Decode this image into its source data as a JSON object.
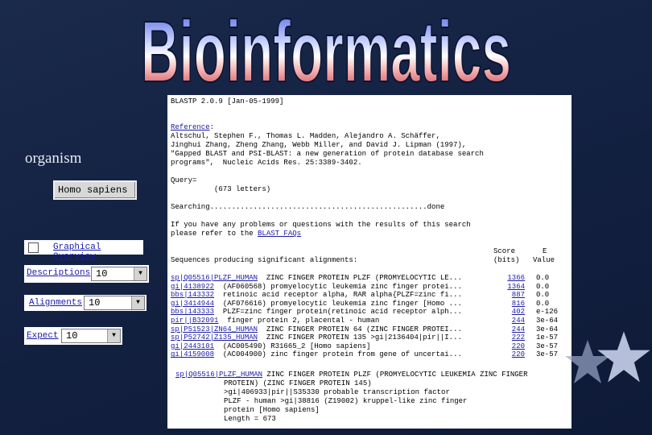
{
  "title": "Bioinformatics",
  "organism": {
    "label": "organism",
    "value": "Homo sapiens"
  },
  "options": {
    "graphical_overview": "Graphical Overview",
    "descriptions": {
      "label": "Descriptions",
      "value": "10"
    },
    "alignments": {
      "label": "Alignments",
      "value": "10"
    },
    "expect": {
      "label": "Expect",
      "value": "10"
    }
  },
  "result": {
    "version": "BLASTP 2.0.9 [Jan-05-1999]",
    "reference_label": "Reference",
    "reference_lines": [
      "Altschul, Stephen F., Thomas L. Madden, Alejandro A. Schäffer,",
      "Jinghui Zhang, Zheng Zhang, Webb Miller, and David J. Lipman (1997),",
      "\"Gapped BLAST and PSI-BLAST: a new generation of protein database search",
      "programs\",  Nucleic Acids Res. 25:3389-3402."
    ],
    "query_label": "Query=",
    "query_letters": "(673 letters)",
    "searching": "Searching..................................................done",
    "problems_line1": "If you have any problems or questions with the results of this search",
    "problems_line2": "please refer to the",
    "faq_link": "BLAST FAQs",
    "col_score": "Score",
    "col_bits": "(bits)",
    "col_e": "E",
    "col_value": "Value",
    "sequences_heading": "Sequences producing significant alignments:",
    "hits": [
      {
        "acc": "sp|Q05516|PLZF_HUMAN",
        "desc": "  ZINC FINGER PROTEIN PLZF (PROMYELOCYTIC LE...",
        "score": "1366",
        "e": "0.0"
      },
      {
        "acc": "gi|4138922",
        "desc": "  (AF060568) promyelocytic leukemia zinc finger protei...",
        "score": "1364",
        "e": "0.0"
      },
      {
        "acc": "bbs|143332",
        "desc": "  retinoic acid receptor alpha, RAR alpha{PLZF=zinc fi...",
        "score": "887",
        "e": "0.0"
      },
      {
        "acc": "gi|3414944",
        "desc": "  (AF076616) promyelocytic leukemia zinc finger [Homo ...",
        "score": "816",
        "e": "0.0"
      },
      {
        "acc": "bbs|143333",
        "desc": "  PLZF=zinc finger protein(retinoic acid receptor alph...",
        "score": "402",
        "e": "e-126"
      },
      {
        "acc": "pir||B32091",
        "desc": "  finger protein 2, placental - human",
        "score": "244",
        "e": "3e-64"
      },
      {
        "acc": "sp|P51523|ZN64_HUMAN",
        "desc": "  ZINC FINGER PROTEIN 64 (ZINC FINGER PROTEI...",
        "score": "244",
        "e": "3e-64"
      },
      {
        "acc": "sp|P52742|Z135_HUMAN",
        "desc": "  ZINC FINGER PROTEIN 135 >gi|2136404|pir||I...",
        "score": "222",
        "e": "1e-57"
      },
      {
        "acc": "gi|2443101",
        "desc": "  (AC005490) R31665_2 [Homo sapiens]",
        "score": "220",
        "e": "3e-57"
      },
      {
        "acc": "gi|4159008",
        "desc": "  (AC004900) zinc finger protein from gene of uncertai...",
        "score": "220",
        "e": "3e-57"
      }
    ],
    "detail_acc": "sp|Q05516|PLZF_HUMAN",
    "detail_first": " ZINC FINGER PROTEIN PLZF (PROMYELOCYTIC LEUKEMIA ZINC FINGER",
    "detail_lines": [
      "PROTEIN) (ZINC FINGER PROTEIN 145)",
      ">gi|406933|pir||S35330 probable transcription factor",
      "PLZF - human >gi|38816 (Z19002) kruppel-like zinc finger",
      "protein [Homo sapiens]",
      "Length = 673"
    ]
  },
  "colors": {
    "background": "#142244",
    "link": "#1a1aa8",
    "title_top": "#2b4ad0",
    "title_mid": "#ffffff",
    "title_bottom": "#c01c2a"
  }
}
